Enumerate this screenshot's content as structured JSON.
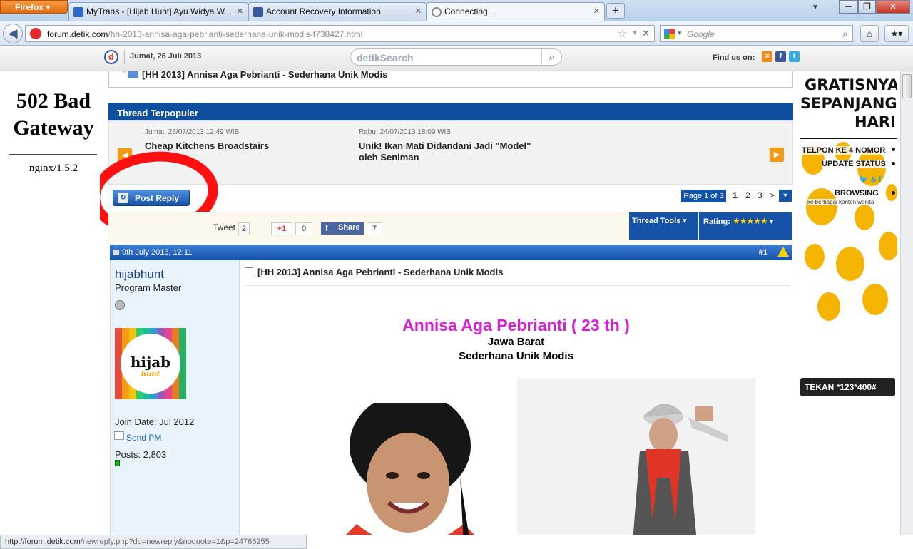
{
  "browser": {
    "app_label": "Firefox",
    "tabs": [
      {
        "label": "MyTrans - [Hijab Hunt] Ayu Widya W..."
      },
      {
        "label": "Account Recovery Information"
      },
      {
        "label": "Connecting..."
      }
    ],
    "new_tab": "+",
    "url_host": "forum.detik.com",
    "url_path": "/hh-2013-annisa-aga-pebrianti-sederhana-unik-modis-t738427.html",
    "search_placeholder": "Google",
    "status_url_host": "http://forum.detik.com",
    "status_url_path": "/newreply.php?do=newreply&noquote=1&p=24766255"
  },
  "detik": {
    "logo": "d",
    "date": "Jumat, 26 Juli 2013",
    "search_label": "detikSearch",
    "find_us": "Find us on:"
  },
  "left_ad": {
    "error_title": "502 Bad Gateway",
    "error_server": "nginx/1.5.2"
  },
  "breadcrumb": {
    "title": "[HH 2013] Annisa Aga Pebrianti - Sederhana Unik Modis"
  },
  "popular": {
    "header": "Thread Terpopuler",
    "items": [
      {
        "date": "Jumat, 26/07/2013 12:49 WIB",
        "title": "Cheap Kitchens Broadstairs"
      },
      {
        "date": "Rabu, 24/07/2013 18:09 WIB",
        "title": "Unik! Ikan Mati Didandani Jadi \"Model\" oleh Seniman"
      }
    ]
  },
  "reply": {
    "label": "Post Reply"
  },
  "pager": {
    "label": "Page 1 of 3",
    "pages": [
      "1",
      "2",
      "3"
    ],
    "next": ">"
  },
  "social": {
    "tweet_label": "Tweet",
    "tweet_count": "2",
    "gplus_label": "+1",
    "gplus_count": "0",
    "share_label": "Share",
    "share_count": "7"
  },
  "tools": {
    "thread_tools": "Thread Tools",
    "rating": "Rating:",
    "stars": "★★★★★"
  },
  "post": {
    "date": "9th July 2013, 12:11",
    "number": "#1",
    "title": "[HH 2013] Annisa Aga Pebrianti - Sederhana Unik Modis",
    "name_line": "Annisa Aga Pebrianti ( 23 th )",
    "line2": "Jawa Barat",
    "line3": "Sederhana Unik Modis"
  },
  "user": {
    "username": "hijabhunt",
    "rank": "Program Master",
    "avatar_text": "hijab",
    "avatar_sub": "hunt",
    "join_date": "Join Date: Jul 2012",
    "send_pm": "Send PM",
    "posts": "Posts: 2,803"
  },
  "right_ad": {
    "headline1": "GRATISNYA",
    "headline2": "SEPANJANG",
    "headline3": "HARI",
    "line_call": "TELPON KE 4 NOMOR",
    "line_update": "UPDATE STATUS",
    "line_browse": "BROWSING",
    "line_sub": "ke berbagai konten wanita",
    "cta": "TEKAN *123*400#"
  },
  "colors": {
    "forum_blue": "#1553a8",
    "accent_magenta": "#d51fd5",
    "ad_yellow": "#f5b400",
    "highlight_red": "#ff1010"
  }
}
